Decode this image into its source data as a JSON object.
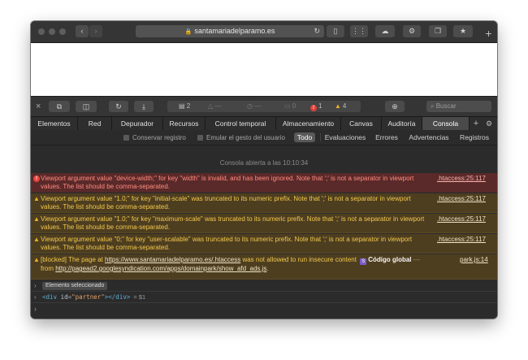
{
  "titlebar": {
    "address": "santamariadelparamo.es",
    "new_tab": "+"
  },
  "inspector_toolbar": {
    "close": "×",
    "resources_count": "2",
    "network_placeholder": "—",
    "timeline_placeholder": "—",
    "logs_count": "0",
    "errors_count": "1",
    "warnings_count": "4",
    "search_placeholder": "Buscar"
  },
  "tabs": [
    {
      "label": "Elementos"
    },
    {
      "label": "Red"
    },
    {
      "label": "Depurador"
    },
    {
      "label": "Recursos"
    },
    {
      "label": "Control temporal"
    },
    {
      "label": "Almacenamiento"
    },
    {
      "label": "Canvas"
    },
    {
      "label": "Auditoría"
    },
    {
      "label": "Consola",
      "active": true
    }
  ],
  "filterbar": {
    "preserve_log": "Conservar registro",
    "emulate_gesture": "Emular el gesto del usuario",
    "levels": [
      "Todo",
      "Evaluaciones",
      "Errores",
      "Advertencias",
      "Registros"
    ],
    "active_level": "Todo"
  },
  "console": {
    "session_label": "Consola abierta a las 10:10:34",
    "messages": [
      {
        "level": "error",
        "text": "Viewport argument value \"device-width;\" for key \"width\" is invalid, and has been ignored. Note that ';' is not a separator in viewport values. The list should be comma-separated.",
        "source": ".htaccess:25:117"
      },
      {
        "level": "warning",
        "text": "Viewport argument value \"1.0;\" for key \"initial-scale\" was truncated to its numeric prefix. Note that ';' is not a separator in viewport values. The list should be comma-separated.",
        "source": ".htaccess:25:117"
      },
      {
        "level": "warning",
        "text": "Viewport argument value \"1.0;\" for key \"maximum-scale\" was truncated to its numeric prefix. Note that ';' is not a separator in viewport values. The list should be comma-separated.",
        "source": ".htaccess:25:117"
      },
      {
        "level": "warning",
        "text": "Viewport argument value \"0;\" for key \"user-scalable\" was truncated to its numeric prefix. Note that ';' is not a separator in viewport values. The list should be comma-separated.",
        "source": ".htaccess:25:117"
      }
    ],
    "blocked": {
      "prefix": "[blocked] The page at ",
      "page_url": "https://www.santamariadelparamo.es/.htaccess",
      "middle": " was not allowed to run insecure content ",
      "badge": "S",
      "code_global": "Código global",
      "dash": " — ",
      "source": "park.js:14",
      "from": "from ",
      "content_url": "http://pagead2.googlesyndication.com/apps/domainpark/show_afd_ads.js",
      "period": "."
    },
    "selected_label": "Elemento seleccionado",
    "result": {
      "open": "<div ",
      "attr": "id",
      "eq": "=",
      "value": "\"partner\"",
      "close": "></div>",
      "var": "= $1"
    }
  },
  "colors": {
    "error_bg": "#5a2929",
    "error_text": "#ff8c80",
    "warning_bg": "#4e3e20",
    "warning_text": "#f2c94c",
    "active_tab": "#4a4a4a"
  }
}
